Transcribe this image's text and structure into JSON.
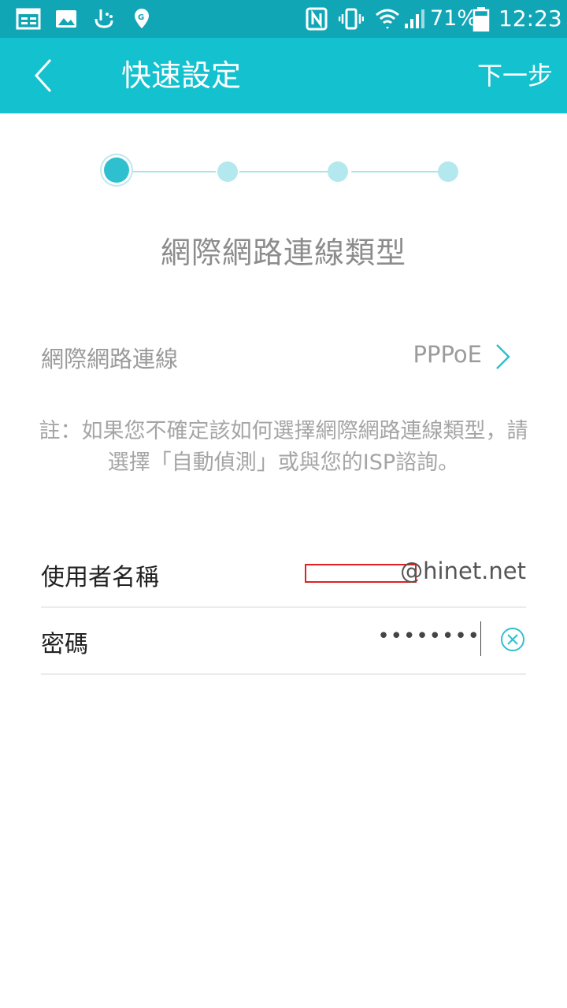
{
  "status_bar": {
    "icons_left": [
      "calendar-icon",
      "image-icon",
      "touchpal-icon",
      "maps-icon"
    ],
    "icons_right": [
      "nfc-icon",
      "vibrate-icon",
      "wifi-icon",
      "signal-icon",
      "battery-icon"
    ],
    "battery": "71%",
    "time": "12:23"
  },
  "app_bar": {
    "title": "快速設定",
    "next_label": "下一步",
    "color": "#14c1cf"
  },
  "stepper": {
    "total_steps": 4,
    "current_step": 1
  },
  "section_title": "網際網路連線類型",
  "connection": {
    "label": "網際網路連線",
    "value": "PPPoE"
  },
  "note": "註：如果您不確定該如何選擇網際網路連線類型，請選擇「自動偵測」或與您的ISP諮詢。",
  "username": {
    "label": "使用者名稱",
    "suffix": "@hinet.net"
  },
  "password": {
    "label": "密碼",
    "value": "••••••••"
  },
  "accent_color": "#2fc0cf"
}
